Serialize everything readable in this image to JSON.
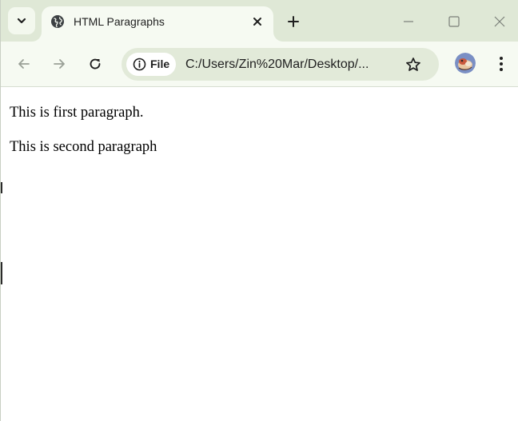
{
  "browser": {
    "tab": {
      "title": "HTML Paragraphs",
      "favicon": "globe-icon"
    },
    "toolbar": {
      "site_chip_label": "File",
      "url": "C:/Users/Zin%20Mar/Desktop/..."
    },
    "icons": {
      "tab_search": "chevron-down-icon",
      "tab_close": "close-icon",
      "new_tab": "plus-icon",
      "minimize": "minimize-icon",
      "maximize": "maximize-icon",
      "close_window": "close-icon",
      "back": "arrow-left-icon",
      "forward": "arrow-right-icon",
      "reload": "reload-icon",
      "site_info": "info-icon",
      "bookmark": "star-icon",
      "profile": "avatar",
      "menu": "kebab-menu-icon"
    },
    "colors": {
      "tabstrip_bg": "#dfe8d6",
      "toolbar_bg": "#f6faf2",
      "omnibox_bg": "#e2ead9"
    }
  },
  "page": {
    "paragraphs": [
      "This is first paragraph.",
      "This is second paragraph"
    ]
  }
}
